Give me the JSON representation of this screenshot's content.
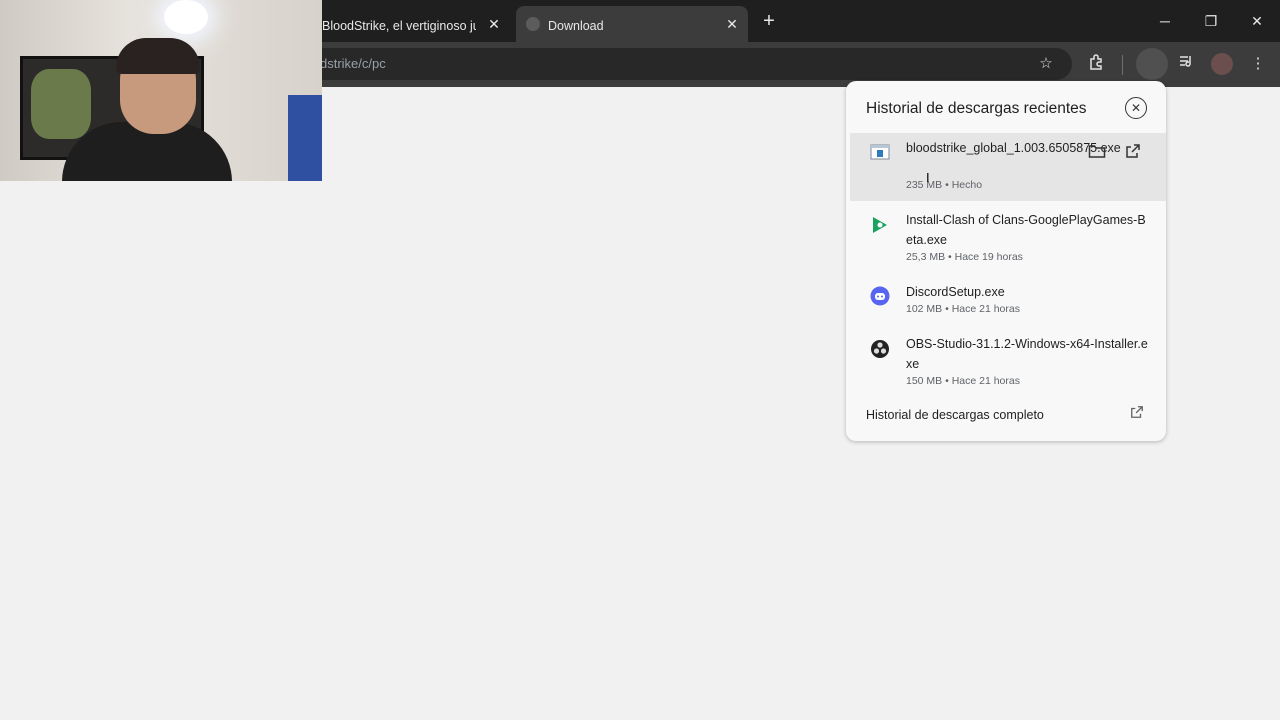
{
  "tabs": [
    {
      "title": "BloodStrike, el vertiginoso jueg",
      "close": "✕"
    },
    {
      "title": "Download",
      "close": "✕"
    }
  ],
  "new_tab": "+",
  "window_controls": {
    "minimize": "─",
    "maximize": "❐",
    "close": "✕"
  },
  "toolbar": {
    "url": "dstrike/c/pc",
    "bookmark_icon": "star-icon",
    "extensions_icon": "puzzle-icon",
    "media_icon": "media-icon",
    "menu_icon": "kebab-icon"
  },
  "downloads": {
    "title": "Historial de descargas recientes",
    "items": [
      {
        "name": "bloodstrike_global_1.003.6505875.exe",
        "meta": "235 MB • Hecho",
        "icon": "exe-icon",
        "icon_color": "#2f7ab8"
      },
      {
        "name": "Install-Clash of Clans-GooglePlayGames-Beta.exe",
        "meta": "25,3 MB • Hace 19 horas",
        "icon": "google-play-games-icon",
        "icon_color": "#1aa260"
      },
      {
        "name": "DiscordSetup.exe",
        "meta": "102 MB • Hace 21 horas",
        "icon": "discord-icon",
        "icon_color": "#5865f2"
      },
      {
        "name": "OBS-Studio-31.1.2-Windows-x64-Installer.exe",
        "meta": "150 MB • Hace 21 horas",
        "icon": "obs-icon",
        "icon_color": "#222222"
      }
    ],
    "full_history": "Historial de descargas completo"
  }
}
